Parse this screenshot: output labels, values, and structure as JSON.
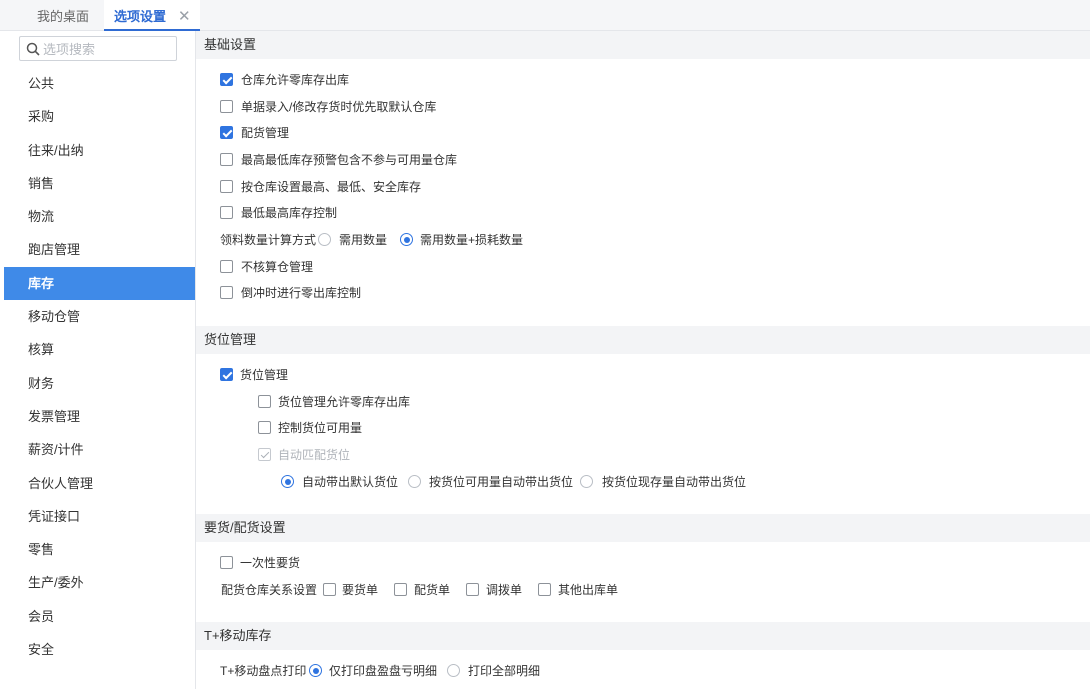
{
  "tabs": [
    {
      "label": "我的桌面"
    },
    {
      "label": "选项设置",
      "close": "✕"
    }
  ],
  "search": {
    "placeholder": "选项搜索"
  },
  "sidebar": {
    "items": [
      {
        "label": "公共"
      },
      {
        "label": "采购"
      },
      {
        "label": "往来/出纳"
      },
      {
        "label": "销售"
      },
      {
        "label": "物流"
      },
      {
        "label": "跑店管理"
      },
      {
        "label": "库存"
      },
      {
        "label": "移动仓管"
      },
      {
        "label": "核算"
      },
      {
        "label": "财务"
      },
      {
        "label": "发票管理"
      },
      {
        "label": "薪资/计件"
      },
      {
        "label": "合伙人管理"
      },
      {
        "label": "凭证接口"
      },
      {
        "label": "零售"
      },
      {
        "label": "生产/委外"
      },
      {
        "label": "会员"
      },
      {
        "label": "安全"
      }
    ],
    "active": "库存"
  },
  "sections": {
    "basic": {
      "title": "基础设置",
      "options": [
        {
          "label": "仓库允许零库存出库",
          "checked": true
        },
        {
          "label": "单据录入/修改存货时优先取默认仓库",
          "checked": false
        },
        {
          "label": "配货管理",
          "checked": true
        },
        {
          "label": "最高最低库存预警包含不参与可用量仓库",
          "checked": false
        },
        {
          "label": "按仓库设置最高、最低、安全库存",
          "checked": false
        },
        {
          "label": "最低最高库存控制",
          "checked": false
        }
      ],
      "calc_label": "领料数量计算方式",
      "calc_options": [
        {
          "label": "需用数量",
          "selected": false
        },
        {
          "label": "需用数量+损耗数量",
          "selected": true
        }
      ],
      "options2": [
        {
          "label": "不核算仓管理",
          "checked": false
        },
        {
          "label": "倒冲时进行零出库控制",
          "checked": false
        }
      ]
    },
    "location": {
      "title": "货位管理",
      "main_option": {
        "label": "货位管理",
        "checked": true
      },
      "sub_options": [
        {
          "label": "货位管理允许零库存出库",
          "checked": false
        },
        {
          "label": "控制货位可用量",
          "checked": false
        },
        {
          "label": "自动匹配货位",
          "checked": true,
          "disabled": true
        }
      ],
      "radio_options": [
        {
          "label": "自动带出默认货位",
          "selected": true
        },
        {
          "label": "按货位可用量自动带出货位",
          "selected": false
        },
        {
          "label": "按货位现存量自动带出货位",
          "selected": false
        }
      ]
    },
    "distribution": {
      "title": "要货/配货设置",
      "option": {
        "label": "一次性要货",
        "checked": false
      },
      "rel_label": "配货仓库关系设置",
      "rel_options": [
        {
          "label": "要货单",
          "checked": false
        },
        {
          "label": "配货单",
          "checked": false
        },
        {
          "label": "调拨单",
          "checked": false
        },
        {
          "label": "其他出库单",
          "checked": false
        }
      ]
    },
    "mobile": {
      "title": "T+移动库存",
      "print_label": "T+移动盘点打印",
      "print_options": [
        {
          "label": "仅打印盘盈盘亏明细",
          "selected": true
        },
        {
          "label": "打印全部明细",
          "selected": false
        }
      ]
    }
  },
  "colors": {
    "accent": "#2f74e0",
    "active_nav": "#3f8ae8",
    "section_bg": "#f3f4f6"
  }
}
